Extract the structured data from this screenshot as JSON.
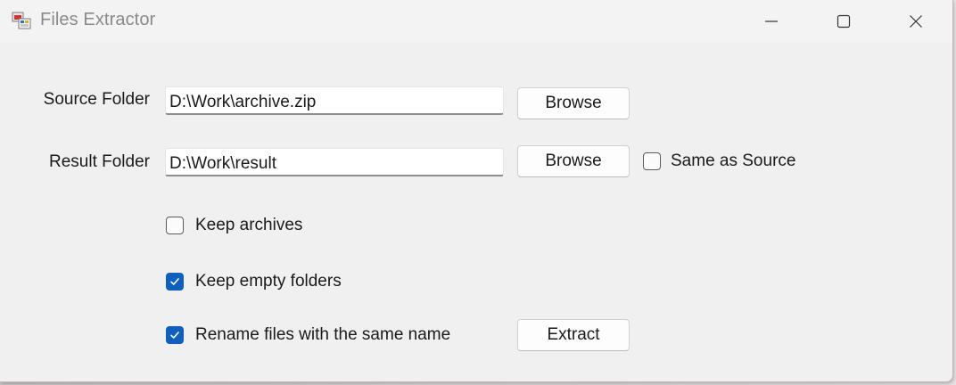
{
  "window": {
    "title": "Files Extractor"
  },
  "form": {
    "source_label": "Source Folder",
    "source_value": "D:\\Work\\archive.zip",
    "source_browse": "Browse",
    "result_label": "Result Folder",
    "result_value": "D:\\Work\\result",
    "result_browse": "Browse",
    "same_as_source": {
      "label": "Same as Source",
      "checked": false
    },
    "keep_archives": {
      "label": "Keep archives",
      "checked": false
    },
    "keep_empty_folders": {
      "label": "Keep empty folders",
      "checked": true
    },
    "rename_same_name": {
      "label": "Rename files with the same name",
      "checked": true
    },
    "extract_button": "Extract"
  },
  "colors": {
    "accent": "#0f5fbf",
    "window_bg": "#f0f0f0"
  },
  "icons": {
    "app": "app-window-icon",
    "minimize": "minimize-icon",
    "maximize": "maximize-icon",
    "close": "close-icon",
    "check": "checkmark-icon"
  }
}
